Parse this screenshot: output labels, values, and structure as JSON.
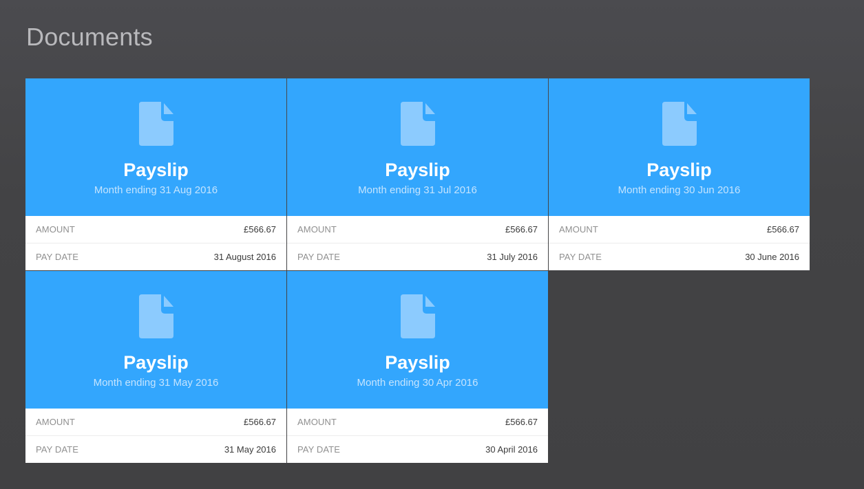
{
  "page": {
    "title": "Documents"
  },
  "colors": {
    "card_header": "#33a6fd",
    "icon": "#8ccbfe",
    "subtitle": "#c4e4fe",
    "background": "#434345"
  },
  "cards": [
    {
      "icon": "document-icon",
      "title": "Payslip",
      "subtitle": "Month ending 31 Aug 2016",
      "amount_label": "AMOUNT",
      "amount": "£566.67",
      "pay_date_label": "PAY DATE",
      "pay_date": "31 August 2016"
    },
    {
      "icon": "document-icon",
      "title": "Payslip",
      "subtitle": "Month ending 31 Jul 2016",
      "amount_label": "AMOUNT",
      "amount": "£566.67",
      "pay_date_label": "PAY DATE",
      "pay_date": "31 July 2016"
    },
    {
      "icon": "document-icon",
      "title": "Payslip",
      "subtitle": "Month ending 30 Jun 2016",
      "amount_label": "AMOUNT",
      "amount": "£566.67",
      "pay_date_label": "PAY DATE",
      "pay_date": "30 June 2016"
    },
    {
      "icon": "document-icon",
      "title": "Payslip",
      "subtitle": "Month ending 31 May 2016",
      "amount_label": "AMOUNT",
      "amount": "£566.67",
      "pay_date_label": "PAY DATE",
      "pay_date": "31 May 2016"
    },
    {
      "icon": "document-icon",
      "title": "Payslip",
      "subtitle": "Month ending 30 Apr 2016",
      "amount_label": "AMOUNT",
      "amount": "£566.67",
      "pay_date_label": "PAY DATE",
      "pay_date": "30 April 2016"
    }
  ]
}
